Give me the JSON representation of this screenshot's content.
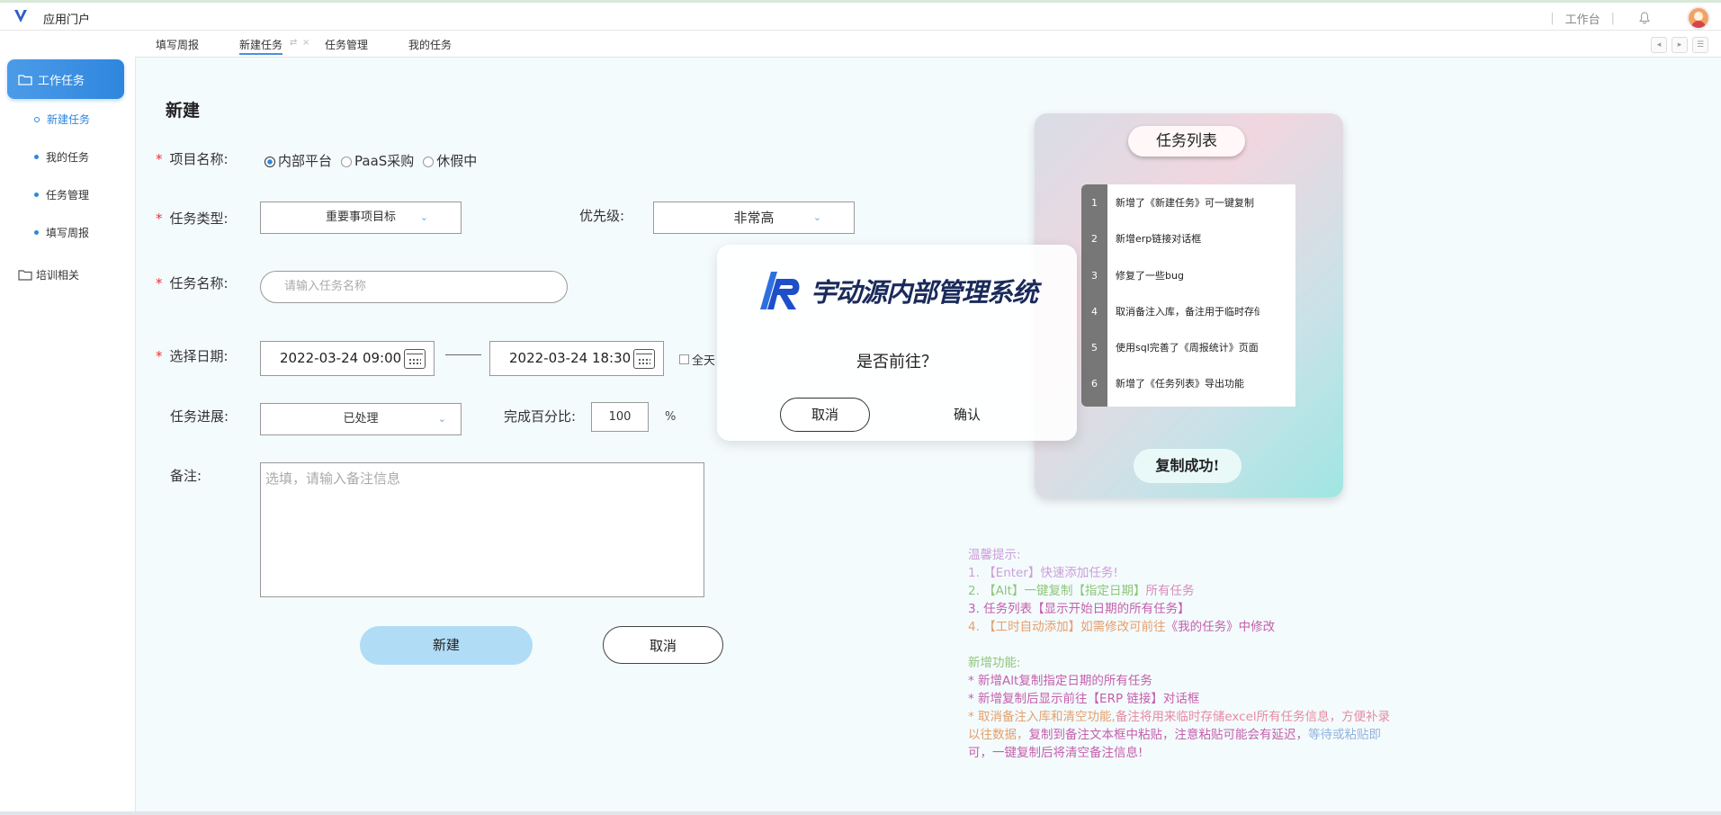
{
  "app": {
    "title": "应用门户"
  },
  "header": {
    "workbench": "工作台"
  },
  "tabs": [
    {
      "label": "填写周报"
    },
    {
      "label": "新建任务"
    },
    {
      "label": "任务管理"
    },
    {
      "label": "我的任务"
    }
  ],
  "sidebar": {
    "main": "工作任务",
    "items": [
      {
        "label": "新建任务"
      },
      {
        "label": "我的任务"
      },
      {
        "label": "任务管理"
      },
      {
        "label": "填写周报"
      }
    ],
    "group2": "培训相关"
  },
  "form": {
    "heading": "新建",
    "project_label": "项目名称:",
    "project_options": [
      "内部平台",
      "PaaS采购",
      "休假中"
    ],
    "type_label": "任务类型:",
    "type_value": "重要事项目标",
    "priority_label": "优先级:",
    "priority_value": "非常高",
    "name_label": "任务名称:",
    "name_placeholder": "请输入任务名称",
    "date_label": "选择日期:",
    "date_start": "2022-03-24 09:00",
    "date_end": "2022-03-24 18:30",
    "allday": "全天",
    "progress_label": "任务进展:",
    "progress_value": "已处理",
    "percent_label": "完成百分比:",
    "percent_value": "100",
    "percent_sign": "%",
    "note_label": "备注:",
    "note_placeholder": "选填，请输入备注信息",
    "create_btn": "新建",
    "cancel_btn": "取消"
  },
  "panel": {
    "title": "任务列表",
    "rows": [
      {
        "n": "1",
        "text": "新增了《新建任务》可一键复制"
      },
      {
        "n": "2",
        "text": "新增erp链接对话框"
      },
      {
        "n": "3",
        "text": "修复了一些bug"
      },
      {
        "n": "4",
        "text": "取消备注入库，备注用于临时存储"
      },
      {
        "n": "5",
        "text": "使用sql完善了《周报统计》页面"
      },
      {
        "n": "6",
        "text": "新增了《任务列表》导出功能"
      }
    ],
    "copy_btn": "复制成功!"
  },
  "dialog": {
    "brand": "宇动源内部管理系统",
    "question": "是否前往？",
    "cancel": "取消",
    "confirm": "确认"
  },
  "tips": {
    "title": "温馨提示:",
    "l1a": "1. 【Enter】快速添加任务!",
    "l2a": "2. 【Alt】一键复制【指定日期】",
    "l2b": "所有任务",
    "l3": "3. 任务列表【显示开始日期的所有任务】",
    "l4a": "4. 【工时自动添加】如需修改可前往",
    "l4b": "《我的任务》中修改",
    "new_title": "新增功能:",
    "n1": "* 新增Alt复制指定日期的所有任务",
    "n2a": "* 新增复制后显示前往",
    "n2b": "【ERP 链接】对话框",
    "n3a": "* 取消备注入库和清空功能,",
    "n3b": "备注将用来临时存储excel所有任务信息，方便补录",
    "n3c": "以往数据，",
    "n3d": "复制到备注文本框中粘贴，",
    "n3e": "注意粘贴可能会有延迟，",
    "n3f": "等待或粘贴即",
    "n3g": "可，一键复制后将清空备注信息!"
  },
  "colors": {
    "accent": "#2e86de",
    "create_btn": "#b1dcf5"
  }
}
